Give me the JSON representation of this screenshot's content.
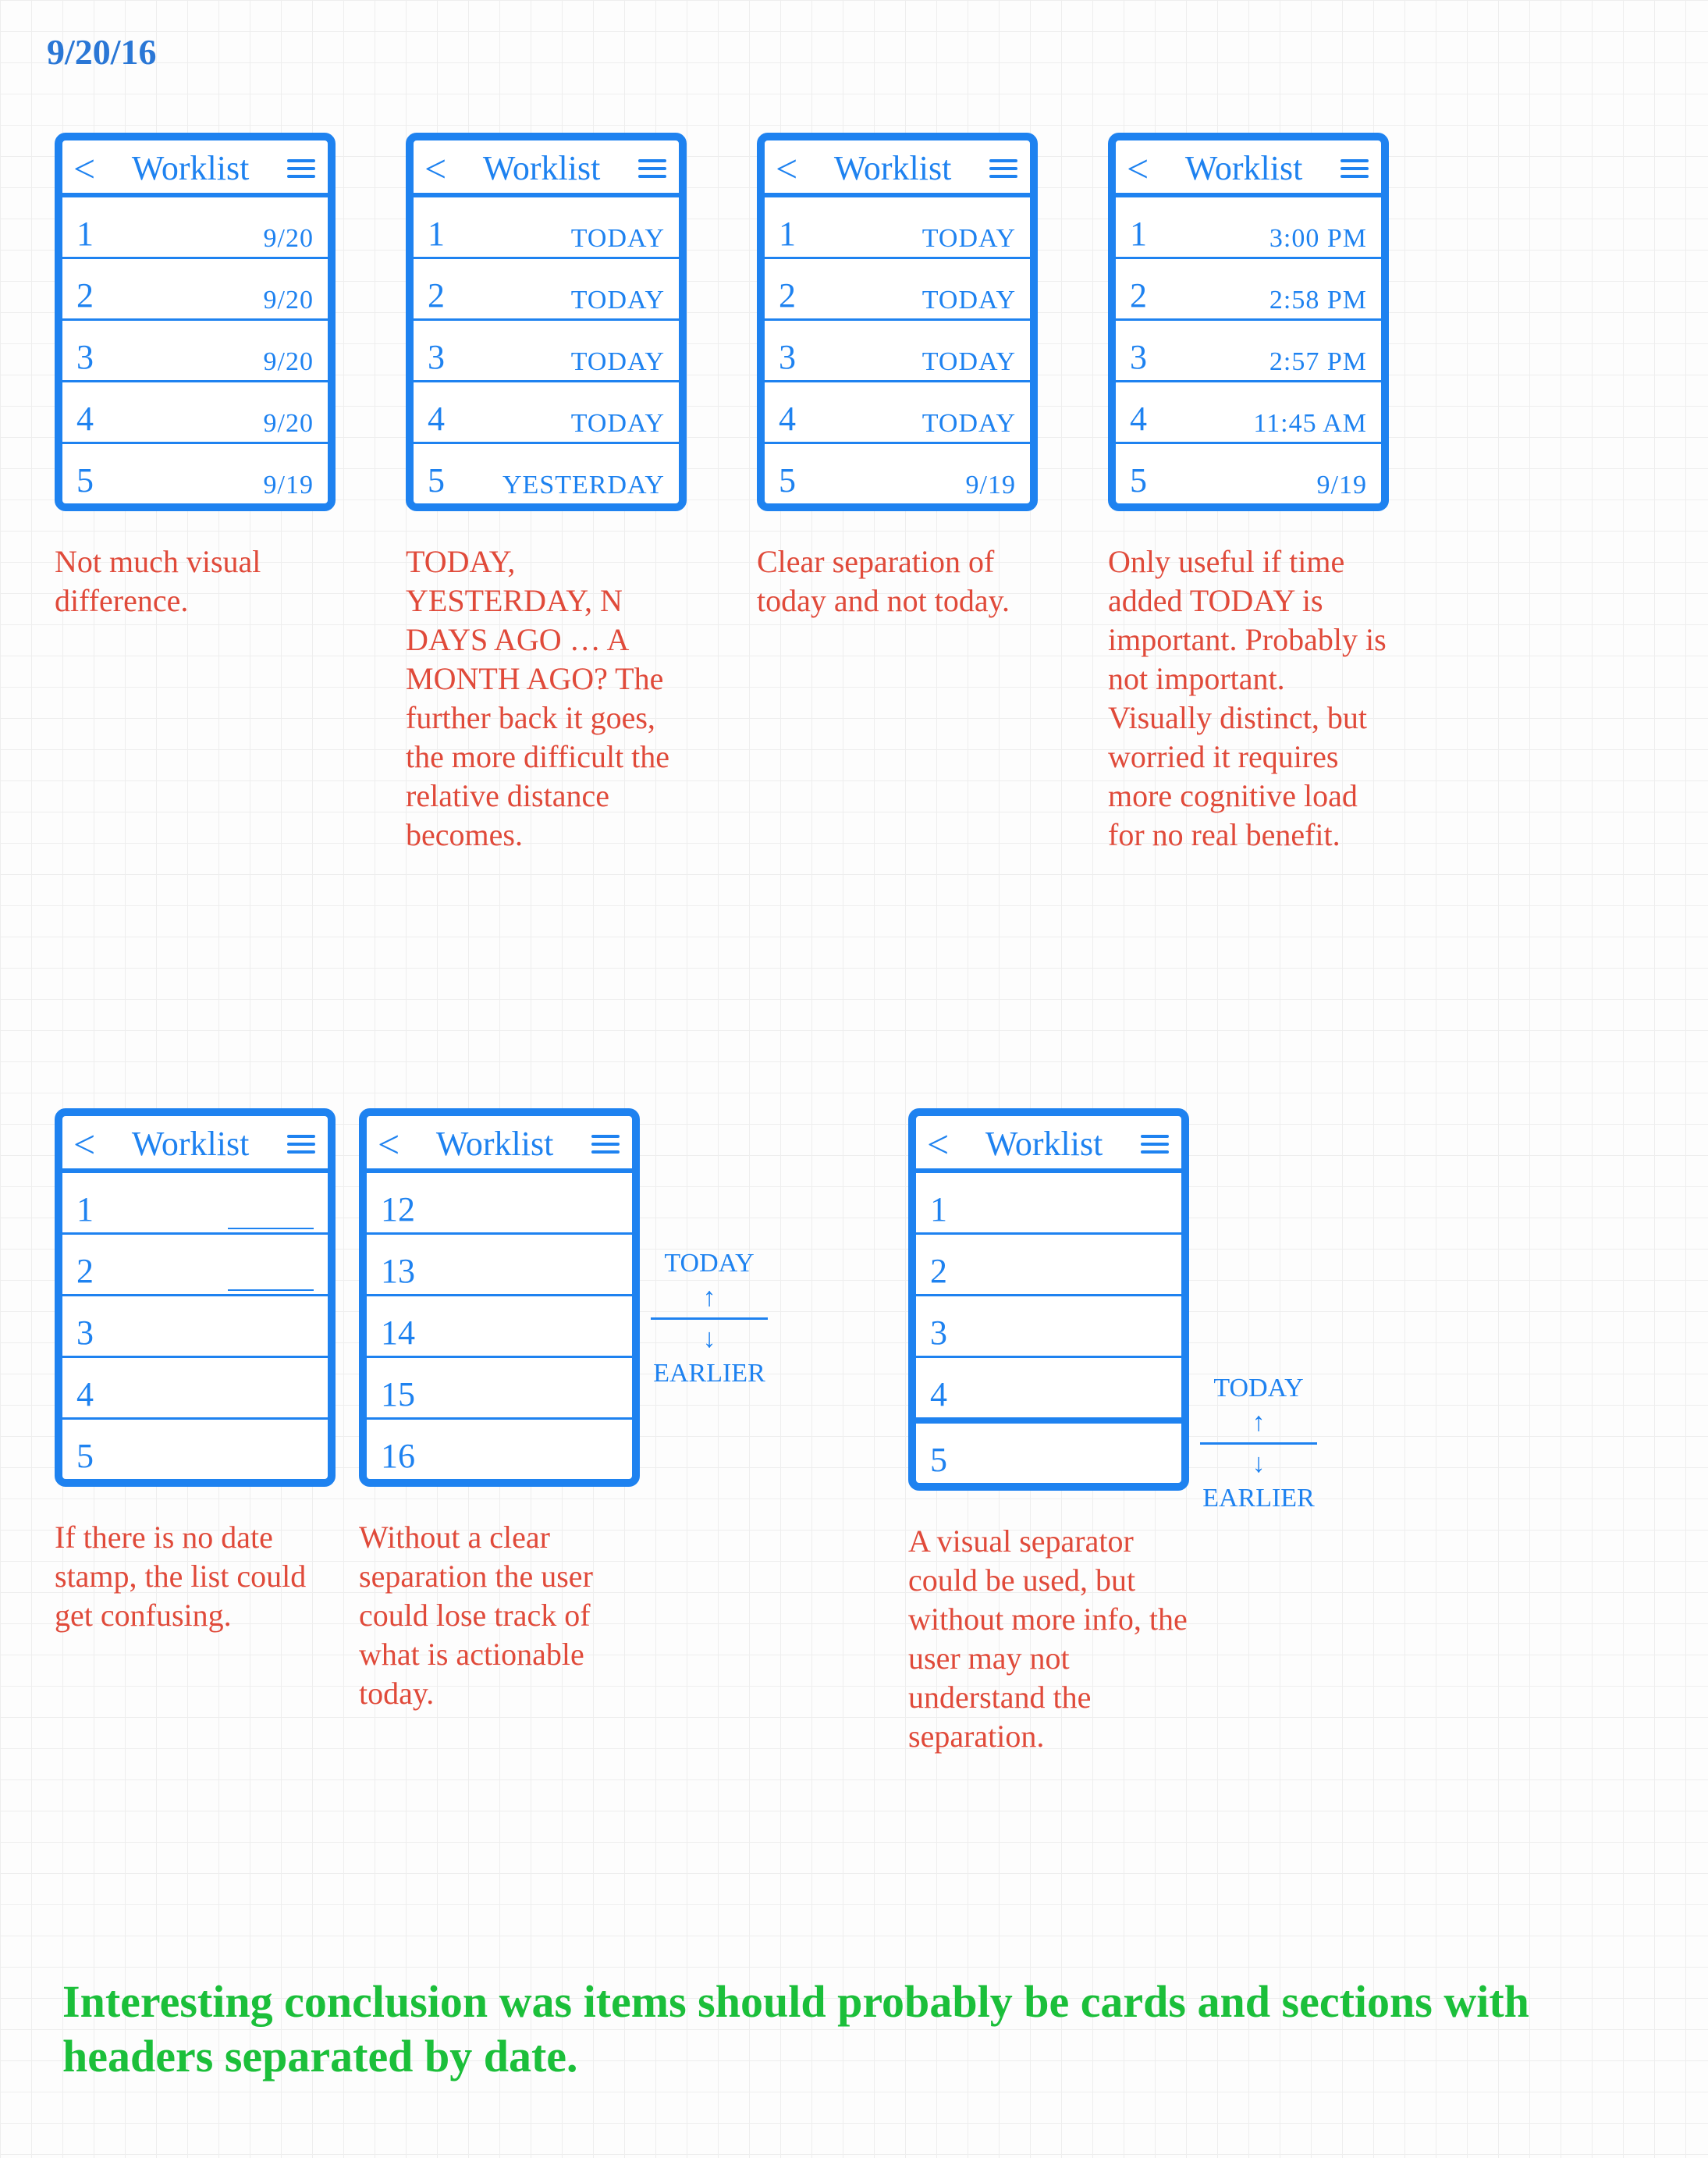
{
  "page_date": "9/20/16",
  "header": {
    "title": "Worklist",
    "back_glyph": "<"
  },
  "variants_row1": [
    {
      "items": [
        {
          "n": "1",
          "d": "9/20"
        },
        {
          "n": "2",
          "d": "9/20"
        },
        {
          "n": "3",
          "d": "9/20"
        },
        {
          "n": "4",
          "d": "9/20"
        },
        {
          "n": "5",
          "d": "9/19"
        }
      ],
      "note": "Not much visual difference."
    },
    {
      "items": [
        {
          "n": "1",
          "d": "TODAY"
        },
        {
          "n": "2",
          "d": "TODAY"
        },
        {
          "n": "3",
          "d": "TODAY"
        },
        {
          "n": "4",
          "d": "TODAY"
        },
        {
          "n": "5",
          "d": "YESTERDAY"
        }
      ],
      "note": "TODAY, YESTERDAY, N DAYS AGO … A MONTH AGO? The further back it goes, the more difficult the relative distance becomes."
    },
    {
      "items": [
        {
          "n": "1",
          "d": "TODAY"
        },
        {
          "n": "2",
          "d": "TODAY"
        },
        {
          "n": "3",
          "d": "TODAY"
        },
        {
          "n": "4",
          "d": "TODAY"
        },
        {
          "n": "5",
          "d": "9/19"
        }
      ],
      "note": "Clear separation of today and not today."
    },
    {
      "items": [
        {
          "n": "1",
          "d": "3:00 PM"
        },
        {
          "n": "2",
          "d": "2:58 PM"
        },
        {
          "n": "3",
          "d": "2:57 PM"
        },
        {
          "n": "4",
          "d": "11:45 AM"
        },
        {
          "n": "5",
          "d": "9/19"
        }
      ],
      "note": "Only useful if time added TODAY is important. Probably is not important. Visually distinct, but worried it requires more cognitive load for no real benefit."
    }
  ],
  "variants_row2": [
    {
      "items": [
        {
          "n": "1",
          "blank": true
        },
        {
          "n": "2",
          "blank": true
        },
        {
          "n": "3",
          "blank": true
        },
        {
          "n": "4",
          "blank": true
        },
        {
          "n": "5",
          "blank": true
        }
      ],
      "note": "If there is no date stamp, the list could get confusing."
    },
    {
      "items": [
        {
          "n": "12"
        },
        {
          "n": "13"
        },
        {
          "n": "14"
        },
        {
          "n": "15"
        },
        {
          "n": "16"
        }
      ],
      "side": {
        "top": "TODAY",
        "bottom": "EARLIER",
        "split_after": 2
      },
      "note": "Without a clear separation the user could lose track of what is actionable today."
    },
    {
      "items": [
        {
          "n": "1"
        },
        {
          "n": "2"
        },
        {
          "n": "3"
        },
        {
          "n": "4",
          "sep": true
        },
        {
          "n": "5"
        }
      ],
      "side": {
        "top": "TODAY",
        "bottom": "EARLIER",
        "split_after": 4
      },
      "note": "A visual separator could be used, but without more info, the user may not understand the separation."
    }
  ],
  "conclusion": "Interesting conclusion was items should probably be cards and sections with headers separated by date."
}
